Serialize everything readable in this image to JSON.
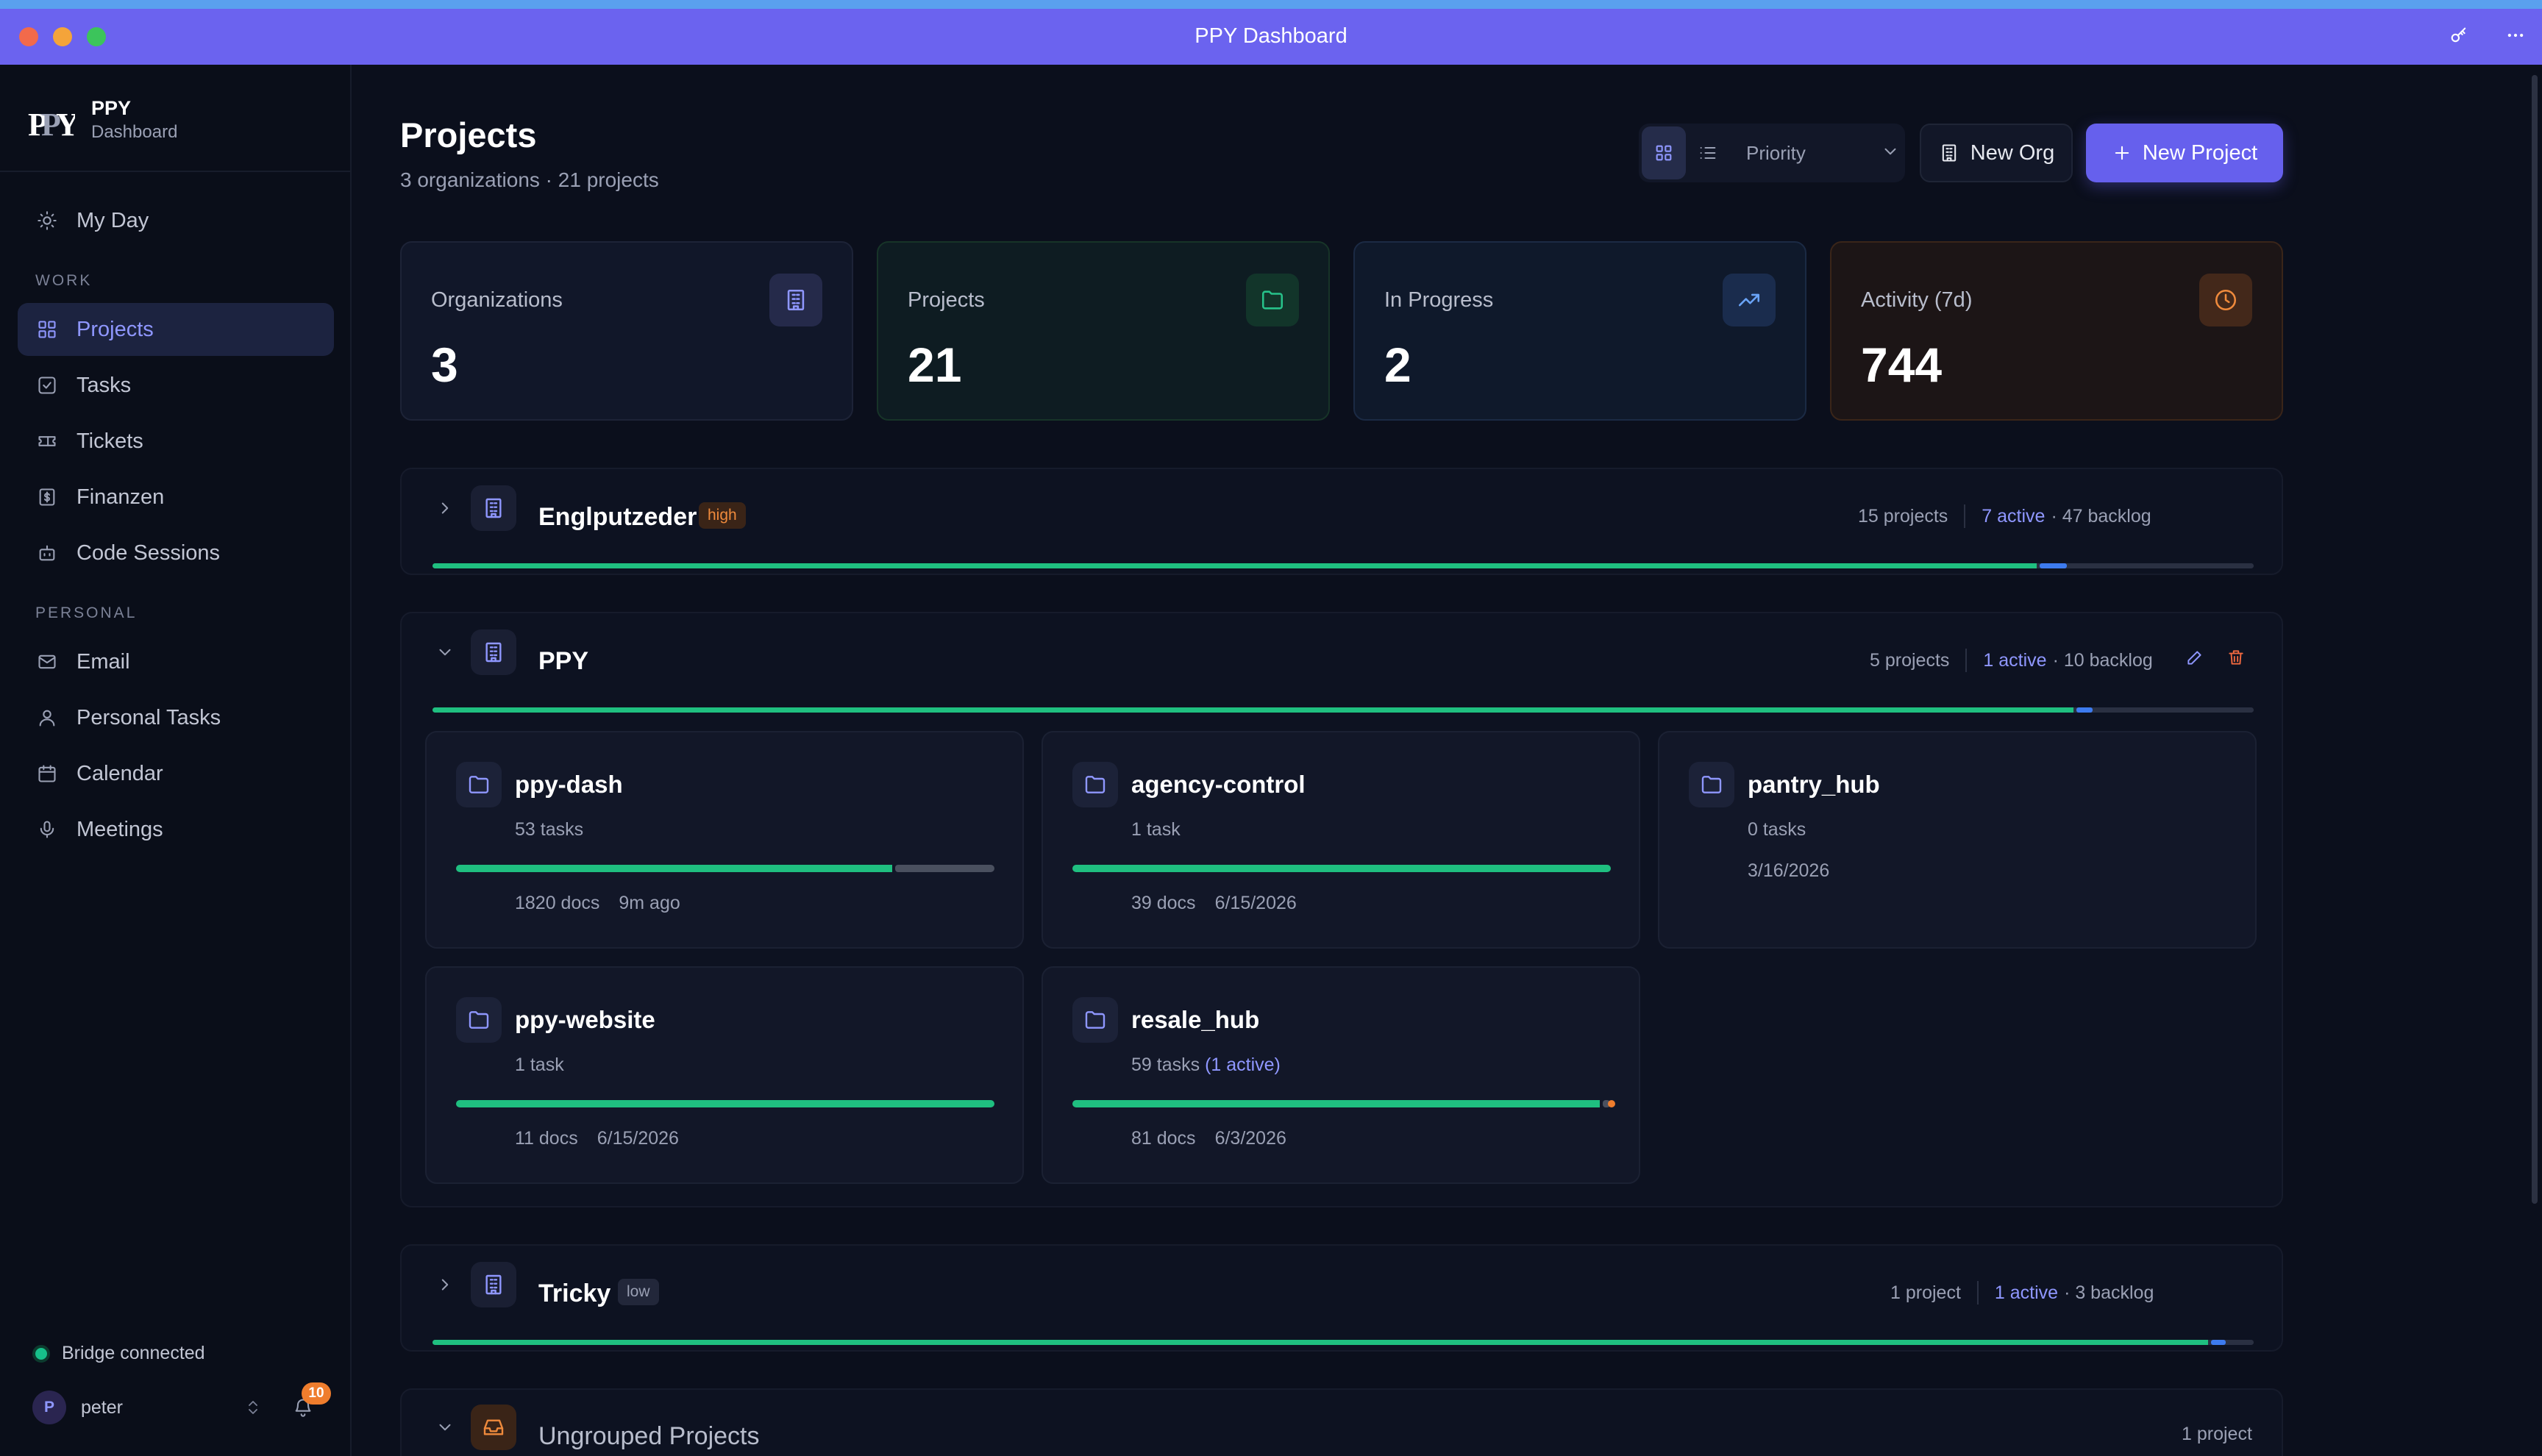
{
  "window": {
    "title": "PPY Dashboard"
  },
  "brand": {
    "title": "PPY",
    "subtitle": "Dashboard"
  },
  "sidebar": {
    "top_item": {
      "label": "My Day"
    },
    "work_label": "WORK",
    "work_items": [
      {
        "label": "Projects",
        "active": true
      },
      {
        "label": "Tasks"
      },
      {
        "label": "Tickets"
      },
      {
        "label": "Finanzen"
      },
      {
        "label": "Code Sessions"
      }
    ],
    "personal_label": "PERSONAL",
    "personal_items": [
      {
        "label": "Email"
      },
      {
        "label": "Personal Tasks"
      },
      {
        "label": "Calendar"
      },
      {
        "label": "Meetings"
      }
    ],
    "bridge_status": "Bridge connected",
    "user": {
      "initial": "P",
      "name": "peter"
    },
    "notifications_count": "10"
  },
  "header": {
    "title": "Projects",
    "subtitle": "3 organizations · 21 projects",
    "sort_value": "Priority",
    "new_org_label": "New Org",
    "new_project_label": "New Project"
  },
  "stats": [
    {
      "label": "Organizations",
      "value": "3",
      "icon": "building-icon",
      "accent": "#8f97ff"
    },
    {
      "label": "Projects",
      "value": "21",
      "icon": "folder-icon",
      "accent": "#27c28a"
    },
    {
      "label": "In Progress",
      "value": "2",
      "icon": "trending-up-icon",
      "accent": "#6aa4f8"
    },
    {
      "label": "Activity (7d)",
      "value": "744",
      "icon": "clock-icon",
      "accent": "#ef8a3c"
    }
  ],
  "orgs": {
    "englputzeder": {
      "name": "Englputzeder",
      "badge": "high",
      "projects": "15 projects",
      "active": "7 active",
      "backlog": "· 47 backlog",
      "progress": {
        "done": 0.881,
        "active": 0.015
      }
    },
    "ppy": {
      "name": "PPY",
      "projects": "5 projects",
      "active": "1 active",
      "backlog": "· 10 backlog",
      "progress": {
        "done": 0.901,
        "active": 0.009
      },
      "cards": [
        {
          "name": "ppy-dash",
          "tasks": "53 tasks",
          "docs": "1820 docs",
          "date": "9m ago",
          "progress": {
            "done": 0.81,
            "active": 0
          },
          "has_bar": true
        },
        {
          "name": "agency-control",
          "tasks": "1 task",
          "docs": "39 docs",
          "date": "6/15/2026",
          "progress": {
            "done": 1.0,
            "active": 0
          },
          "has_bar": true
        },
        {
          "name": "pantry_hub",
          "tasks": "0 tasks",
          "docs": "",
          "date": "3/16/2026",
          "has_bar": false
        },
        {
          "name": "ppy-website",
          "tasks": "1 task",
          "docs": "11 docs",
          "date": "6/15/2026",
          "progress": {
            "done": 1.0,
            "active": 0
          },
          "has_bar": true
        },
        {
          "name": "resale_hub",
          "tasks": "59 tasks",
          "tasks_active": "(1 active)",
          "docs": "81 docs",
          "date": "6/3/2026",
          "progress": {
            "done": 0.98,
            "active": 0
          },
          "has_bar": true
        }
      ]
    },
    "tricky": {
      "name": "Tricky",
      "badge": "low",
      "projects": "1 project",
      "active": "1 active",
      "backlog": "· 3 backlog",
      "progress": {
        "done": 0.975,
        "active": 0.008
      }
    },
    "ungrouped": {
      "name": "Ungrouped Projects",
      "projects": "1 project"
    }
  },
  "colors": {
    "accent": "#6660ed",
    "done": "#1fbf80",
    "active": "#3d7bef",
    "backlog": "#2a3042",
    "high": "#ef8a3c",
    "orange_dot": "#ef7d2d"
  }
}
